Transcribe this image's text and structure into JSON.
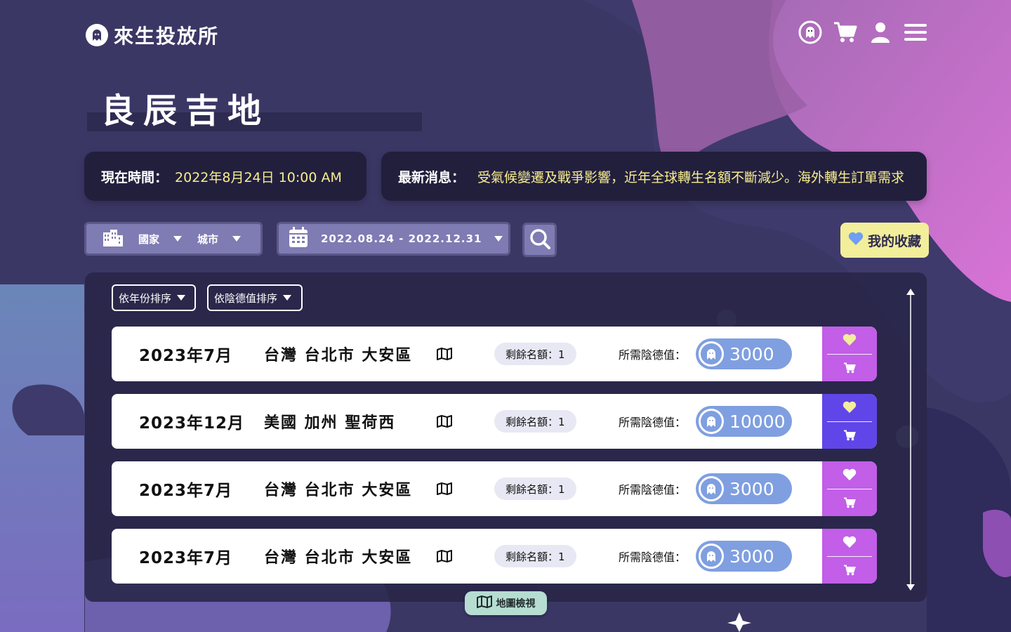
{
  "brand": {
    "name": "來生投放所",
    "logo_icon": "ghost-logo-icon"
  },
  "header": {
    "icons": [
      "ghost-coin-icon",
      "cart-icon",
      "user-icon",
      "menu-icon"
    ]
  },
  "page": {
    "title": "良辰吉地"
  },
  "info": {
    "time_label": "現在時間：",
    "time_value": "2022年8月24日 10:00 AM",
    "news_label": "最新消息：",
    "news_value": "受氣候變遷及戰爭影響，近年全球轉生名額不斷減少。海外轉生訂單需求"
  },
  "filters": {
    "country_label": "國家",
    "city_label": "城市",
    "date_range": "2022.08.24 - 2022.12.31",
    "favorites_label": "我的收藏"
  },
  "sort": {
    "by_year": "依年份排序",
    "by_virtue": "依陰德值排序"
  },
  "listings": [
    {
      "date": "2023年7月",
      "place": "台灣 台北市 大安區",
      "quota": "剩餘名額：1",
      "need_label": "所需陰德值：",
      "cost": "3000",
      "action_color": "#c25ee8"
    },
    {
      "date": "2023年12月",
      "place": "美國 加州 聖荷西",
      "quota": "剩餘名額：1",
      "need_label": "所需陰德值：",
      "cost": "10000",
      "action_color": "#6046e8"
    },
    {
      "date": "2023年7月",
      "place": "台灣 台北市 大安區",
      "quota": "剩餘名額：1",
      "need_label": "所需陰德值：",
      "cost": "3000",
      "action_color": "#c25ee8"
    },
    {
      "date": "2023年7月",
      "place": "台灣 台北市 大安區",
      "quota": "剩餘名額：1",
      "need_label": "所需陰德值：",
      "cost": "3000",
      "action_color": "#c25ee8"
    }
  ],
  "map_view": {
    "label": "地圖檢視"
  },
  "colors": {
    "background": "#3b3765",
    "accent_yellow": "#f7ee8f",
    "accent_pink": "#c25ee8",
    "accent_violet": "#6046e8",
    "coin_blue": "#7f9fe0"
  }
}
